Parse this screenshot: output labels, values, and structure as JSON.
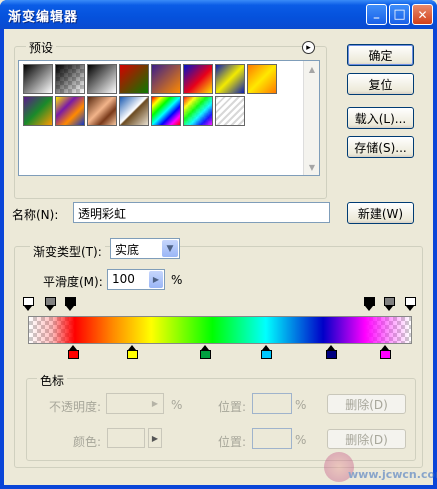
{
  "window": {
    "title": "渐变编辑器",
    "minimize_glyph": "_",
    "maximize_glyph": "□",
    "close_glyph": "✕"
  },
  "presets": {
    "label": "预设",
    "menu_glyph": "▸",
    "swatches": [
      {
        "name": "foreground-to-background",
        "css": "linear-gradient(135deg,#000 0%,#fff 100%)"
      },
      {
        "name": "foreground-to-transparent",
        "css": "linear-gradient(135deg,#000 0%,rgba(0,0,0,0) 100%)"
      },
      {
        "name": "black-white",
        "css": "linear-gradient(135deg,#000 0%,#fff 100%)"
      },
      {
        "name": "red-green",
        "css": "linear-gradient(135deg,#d40000 0%,#0a7a00 100%)"
      },
      {
        "name": "violet-orange",
        "css": "linear-gradient(135deg,#3a1f8a 0%,#ff8a00 100%)"
      },
      {
        "name": "blue-red-yellow",
        "css": "linear-gradient(135deg,#0012c9 0%,#e8001a 55%,#ffe600 100%)"
      },
      {
        "name": "blue-yellow-blue",
        "css": "linear-gradient(135deg,#0b1db0 0%,#f2ea00 50%,#0b1db0 100%)"
      },
      {
        "name": "orange-yellow-orange",
        "css": "linear-gradient(135deg,#ff7a00 0%,#ffe800 50%,#ff7a00 100%)"
      },
      {
        "name": "violet-green-orange",
        "css": "linear-gradient(135deg,#5a1a8a 0%,#1a8a2a 50%,#ff9a00 100%)"
      },
      {
        "name": "yellow-violet-orange-blue",
        "css": "linear-gradient(135deg,#ffe600 0%,#7a1aa6 35%,#ff8a00 65%,#1038c8 100%)"
      },
      {
        "name": "copper",
        "css": "linear-gradient(135deg,#5a2a10 0%,#f2b48a 45%,#7a3a1a 70%,#f6c7a0 100%)"
      },
      {
        "name": "chrome",
        "css": "linear-gradient(135deg,#1a5ab0 0%,#ffffff 48%,#6a4a20 52%,#e8e0d0 100%)"
      },
      {
        "name": "spectrum",
        "css": "linear-gradient(135deg,#ff0000,#ffff00,#00ff00,#00ffff,#0000ff,#ff00ff,#ff0000)"
      },
      {
        "name": "transparent-rainbow",
        "css": "linear-gradient(135deg,rgba(255,0,0,0.9),rgba(255,255,0,0.9),rgba(0,255,0,0.9),rgba(0,255,255,0.9),rgba(0,0,255,0.9),rgba(255,0,255,0.9))"
      },
      {
        "name": "transparent-stripes",
        "css": "repeating-linear-gradient(135deg,#d8d8d8 0px,#d8d8d8 2px,#ffffff 2px,#ffffff 5px)"
      }
    ]
  },
  "buttons": {
    "ok": "确定",
    "reset": "复位",
    "load": "载入(L)...",
    "save": "存储(S)...",
    "new": "新建(W)"
  },
  "name": {
    "label": "名称(N):",
    "value": "透明彩虹"
  },
  "gradient": {
    "type_label": "渐变类型(T):",
    "type_value": "实底",
    "smooth_label": "平滑度(M):",
    "smooth_value": "100",
    "percent": "%",
    "bar_css": "linear-gradient(90deg,rgba(255,0,0,0) 0%,rgba(255,0,0,0.25) 6%,#ff0000 12%,#ff8a00 22%,#ffff00 32%,#00ff00 48%,#00ffff 62%,#0000c8 77%,#ff00ff 88%,rgba(255,0,255,0.35) 95%,rgba(255,0,255,0) 100%)",
    "opacity_stops": [
      {
        "pos": 0.0,
        "color": "#ffffff"
      },
      {
        "pos": 0.058,
        "color": "#808080"
      },
      {
        "pos": 0.11,
        "color": "#000000"
      },
      {
        "pos": 0.887,
        "color": "#000000"
      },
      {
        "pos": 0.939,
        "color": "#808080"
      },
      {
        "pos": 0.995,
        "color": "#ffffff"
      }
    ],
    "color_stops": [
      {
        "pos": 0.118,
        "color": "#ff0000"
      },
      {
        "pos": 0.272,
        "color": "#ffff00"
      },
      {
        "pos": 0.462,
        "color": "#00a040"
      },
      {
        "pos": 0.62,
        "color": "#00c8ff"
      },
      {
        "pos": 0.79,
        "color": "#000080"
      },
      {
        "pos": 0.93,
        "color": "#ff00ff"
      }
    ]
  },
  "stops_group": {
    "label": "色标",
    "opacity_label": "不透明度:",
    "percent": "%",
    "location_label": "位置:",
    "delete_label": "删除(D)",
    "color_label": "颜色:",
    "location2_label": "位置:",
    "delete2_label": "删除(D)"
  },
  "watermark": "www.jcwcn.com"
}
